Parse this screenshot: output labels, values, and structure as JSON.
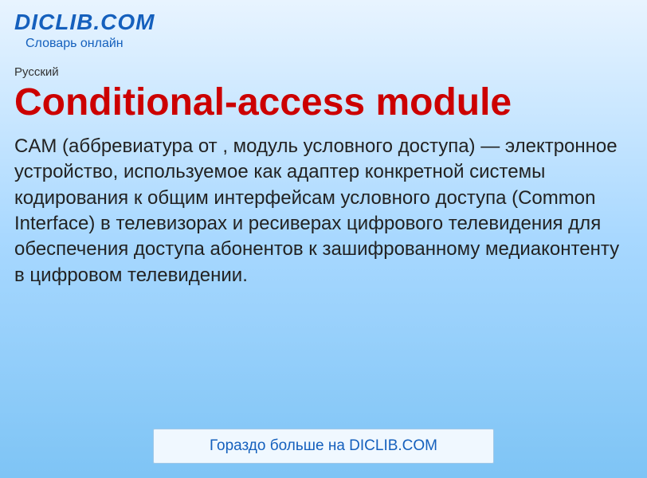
{
  "header": {
    "site_title": "DICLIB.COM",
    "site_subtitle": "Словарь онлайн"
  },
  "language_label": "Русский",
  "page_title": "Conditional-access module",
  "description": "CAM (аббревиатура от , модуль условного доступа) — электронное устройство, используемое как адаптер конкретной системы кодирования к общим интерфейсам условного доступа (Common Interface) в телевизорах и ресиверах цифрового телевидения для обеспечения доступа абонентов к зашифрованному медиаконтенту в цифровом телевидении.",
  "more_link_label": "Гораздо больше на DICLIB.COM",
  "colors": {
    "accent_blue": "#1560bd",
    "title_red": "#cc0000"
  }
}
